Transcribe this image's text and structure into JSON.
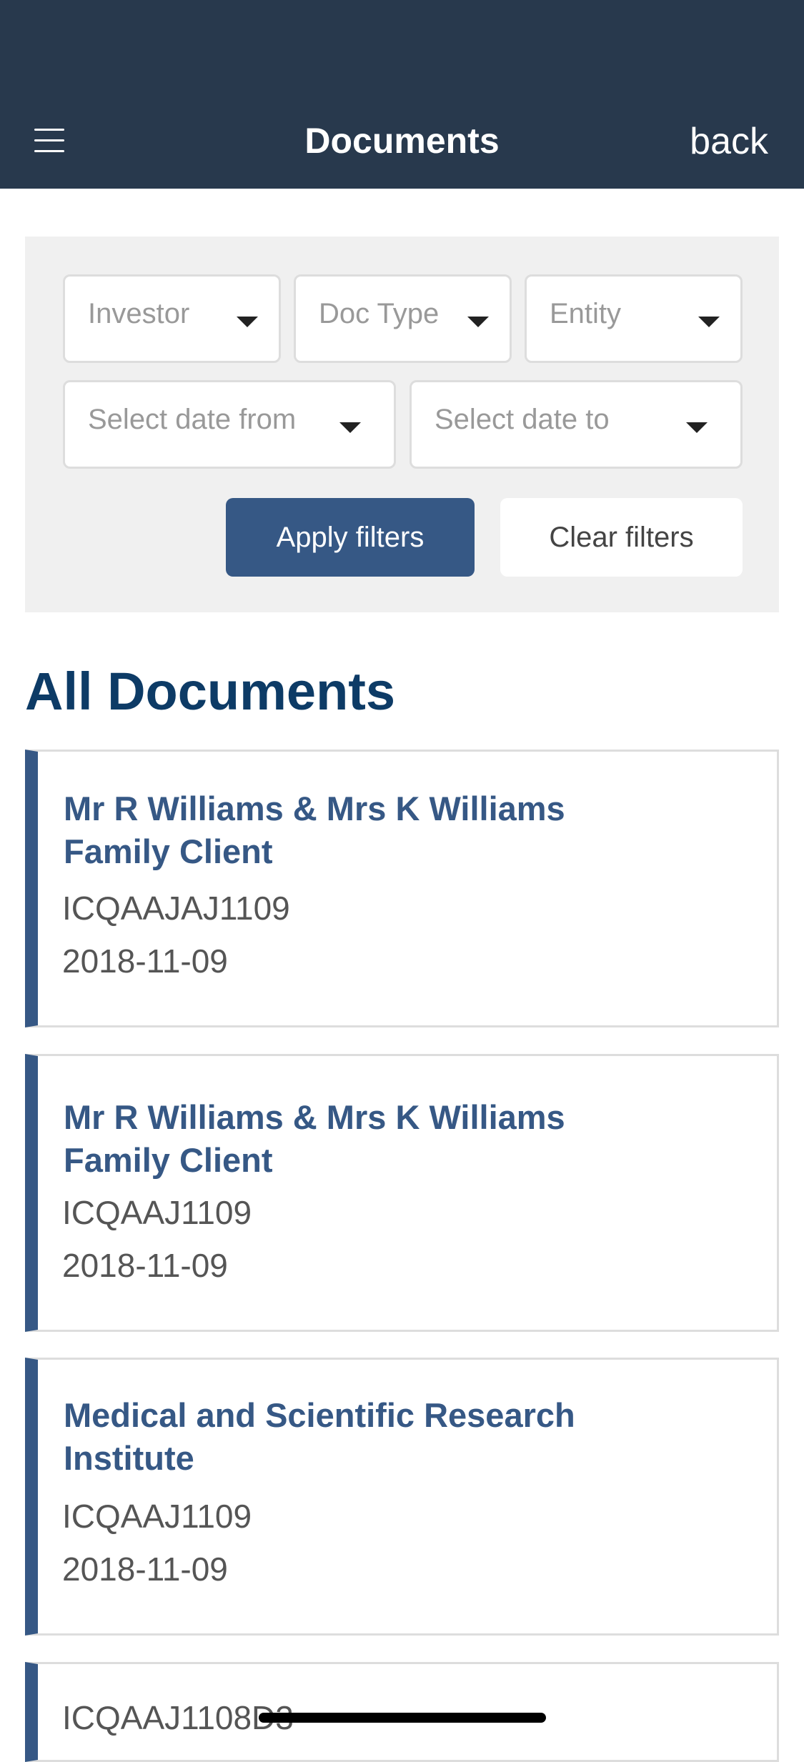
{
  "header": {
    "title": "Documents",
    "back_label": "back",
    "menu_icon": "hamburger-menu-icon",
    "background": "#28394d"
  },
  "filters": {
    "investor_placeholder": "Investor",
    "doc_type_placeholder": "Doc Type",
    "entity_placeholder": "Entity",
    "date_from_placeholder": "Select date from",
    "date_to_placeholder": "Select date to",
    "apply_label": "Apply filters",
    "clear_label": "Clear filters",
    "panel_background": "#f0f0f0",
    "accent": "#365885"
  },
  "section": {
    "title": "All Documents"
  },
  "documents": [
    {
      "title": "Mr R Williams & Mrs K Williams Family Client",
      "code": "ICQAAJAJ1109",
      "date": "2018-11-09"
    },
    {
      "title": "Mr R Williams & Mrs K Williams Family Client",
      "code": "ICQAAJ1109",
      "date": "2018-11-09"
    },
    {
      "title": "Medical and Scientific Research Institute",
      "code": "ICQAAJ1109",
      "date": "2018-11-09"
    },
    {
      "title": "",
      "code": "ICQAAJ1108D3",
      "date": ""
    }
  ]
}
